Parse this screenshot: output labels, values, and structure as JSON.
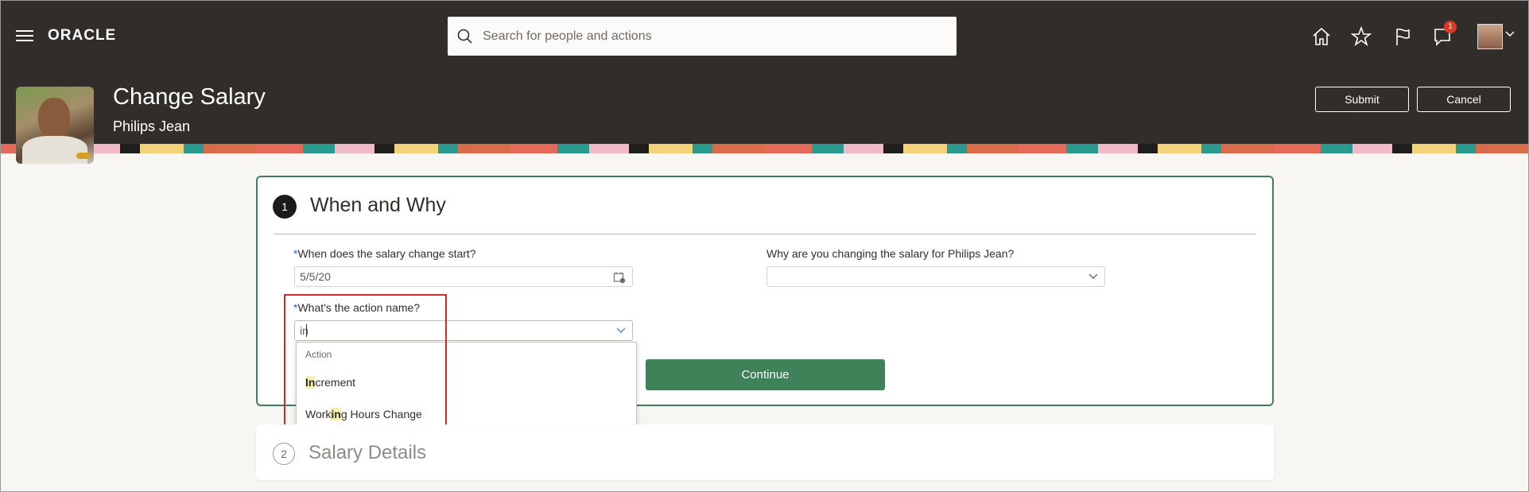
{
  "header": {
    "logo": "ORACLE",
    "search_placeholder": "Search for people and actions",
    "notification_count": "1"
  },
  "page": {
    "title": "Change Salary",
    "employee_name": "Philips Jean",
    "submit_label": "Submit",
    "cancel_label": "Cancel"
  },
  "section1": {
    "number": "1",
    "title": "When and Why",
    "start_label": "When does the salary change start?",
    "start_value": "5/5/20",
    "reason_label": "Why are you changing the salary for Philips Jean?",
    "reason_value": "",
    "action_label": "What's the action name?",
    "action_value": "in",
    "continue_label": "Continue",
    "required_mark": "*"
  },
  "dropdown": {
    "header": "Action",
    "items": [
      {
        "match": "In",
        "rest": "crement"
      },
      {
        "pre": "Work",
        "match": "in",
        "rest": "g Hours Change"
      }
    ]
  },
  "section2": {
    "number": "2",
    "title": "Salary Details"
  },
  "colors": {
    "header_bg": "#312d2a",
    "accent_green": "#3f8159",
    "highlight_red": "#d22a2a"
  }
}
